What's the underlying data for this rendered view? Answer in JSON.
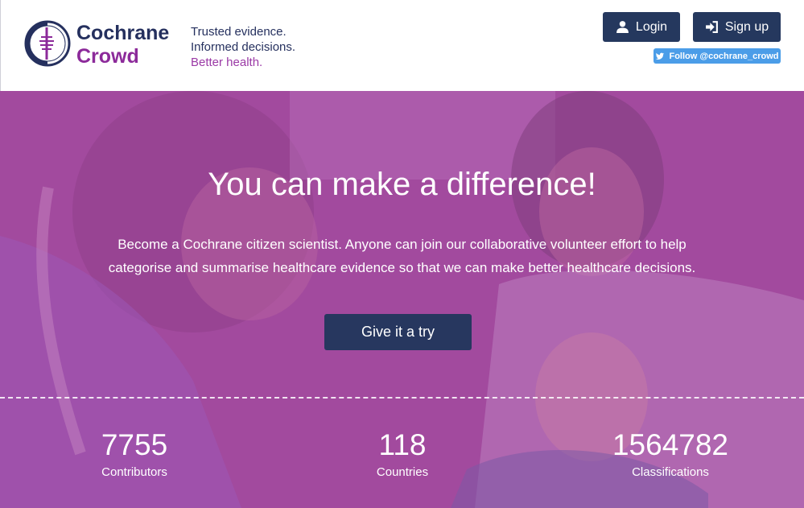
{
  "header": {
    "brand_line1": "Cochrane",
    "brand_line2": "Crowd",
    "tagline_line1": "Trusted evidence.",
    "tagline_line2": "Informed decisions.",
    "tagline_line3": "Better health.",
    "login_label": "Login",
    "signup_label": "Sign up",
    "twitter_label": "Follow @cochrane_crowd"
  },
  "hero": {
    "title": "You can make a difference!",
    "text": "Become a Cochrane citizen scientist. Anyone can join our collaborative volunteer effort to help categorise and summarise healthcare evidence so that we can make better healthcare decisions.",
    "cta_label": "Give it a try"
  },
  "stats": [
    {
      "value": "7755",
      "label": "Contributors"
    },
    {
      "value": "118",
      "label": "Countries"
    },
    {
      "value": "1564782",
      "label": "Classifications"
    }
  ],
  "colors": {
    "navy": "#25305e",
    "purple": "#8c2a9a",
    "hero_overlay": "#a4479f",
    "twitter": "#4b9de8"
  }
}
